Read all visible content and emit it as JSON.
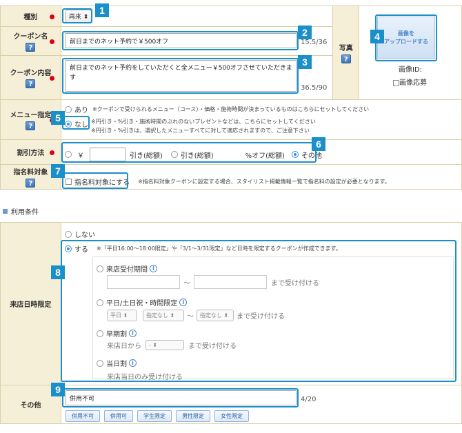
{
  "kind": {
    "label": "種別",
    "value": "再来 ⬍"
  },
  "coupon_name": {
    "label": "クーポン名",
    "value": "前日までのネット予約で￥500オフ",
    "count": "15.5/36"
  },
  "coupon_content": {
    "label": "クーポン内容",
    "value": "前日までのネット予約をしていただくと全メニュー￥500オフさせていただきます",
    "count": "36.5/90"
  },
  "photo": {
    "label": "写真",
    "upload_line1": "画像を",
    "upload_line2": "アップロードする",
    "image_id": "画像ID:",
    "image_apply": "画像応募"
  },
  "menu_spec": {
    "label": "メニュー指定",
    "opt_yes": "あり",
    "opt_yes_note": "※クーポンで受けられるメニュー（コース）・価格・施術時間が決まっているものはこちらにセットしてください",
    "opt_no": "なし",
    "opt_no_note1": "※円引き・%引き・施術時間のぶれのないプレゼントなどは、こちらにセットしてください",
    "opt_no_note2": "※円引き・%引きは、選択したメニューすべてに対して適応されますので、ご注意下さい"
  },
  "discount": {
    "label": "割引方法",
    "yen": "￥",
    "yen_suffix": "引き(総額)",
    "opt2": "引き(総額)",
    "percent": "%オフ(総額)",
    "other": "その他"
  },
  "nomination": {
    "label": "指名料対象",
    "checkbox": "指名料対象にする",
    "note": "※指名料対象クーポンに設定する場合、スタイリスト掲載情報一覧で指名料の設定が必要となります。"
  },
  "section_title": "利用条件",
  "visit_limit": {
    "label": "来店日時限定",
    "opt_no": "しない",
    "opt_yes": "する",
    "opt_yes_note": "※「平日16:00～18:00限定」や「3/1～3/31限定」など日時を限定するクーポンが作成できます。",
    "period_label": "来店受付期間",
    "period_tilde": "～",
    "period_suffix": "まで受け付ける",
    "weekday_label": "平日/土日祝・時間限定",
    "weekday_sel": "平日",
    "time_sel1": "指定なし",
    "time_tilde": "～",
    "time_sel2": "指定なし",
    "time_suffix": "まで受け付ける",
    "early_label": "早期割",
    "early_prefix": "来店日から",
    "early_sel": "-",
    "early_suffix": "まで受け付ける",
    "sameday_label": "当日割",
    "sameday_note": "来店当日のみ受け付ける"
  },
  "other": {
    "label": "その他",
    "value": "併用不可",
    "count": "4/20",
    "buttons": [
      "併用不可",
      "併用可",
      "学生限定",
      "男性限定",
      "女性限定"
    ]
  },
  "badges": [
    "1",
    "2",
    "3",
    "4",
    "5",
    "6",
    "7",
    "8",
    "9"
  ],
  "colors": {
    "accent": "#1a8fc9",
    "label_bg": "#f6efd7",
    "required": "#d9001b"
  }
}
